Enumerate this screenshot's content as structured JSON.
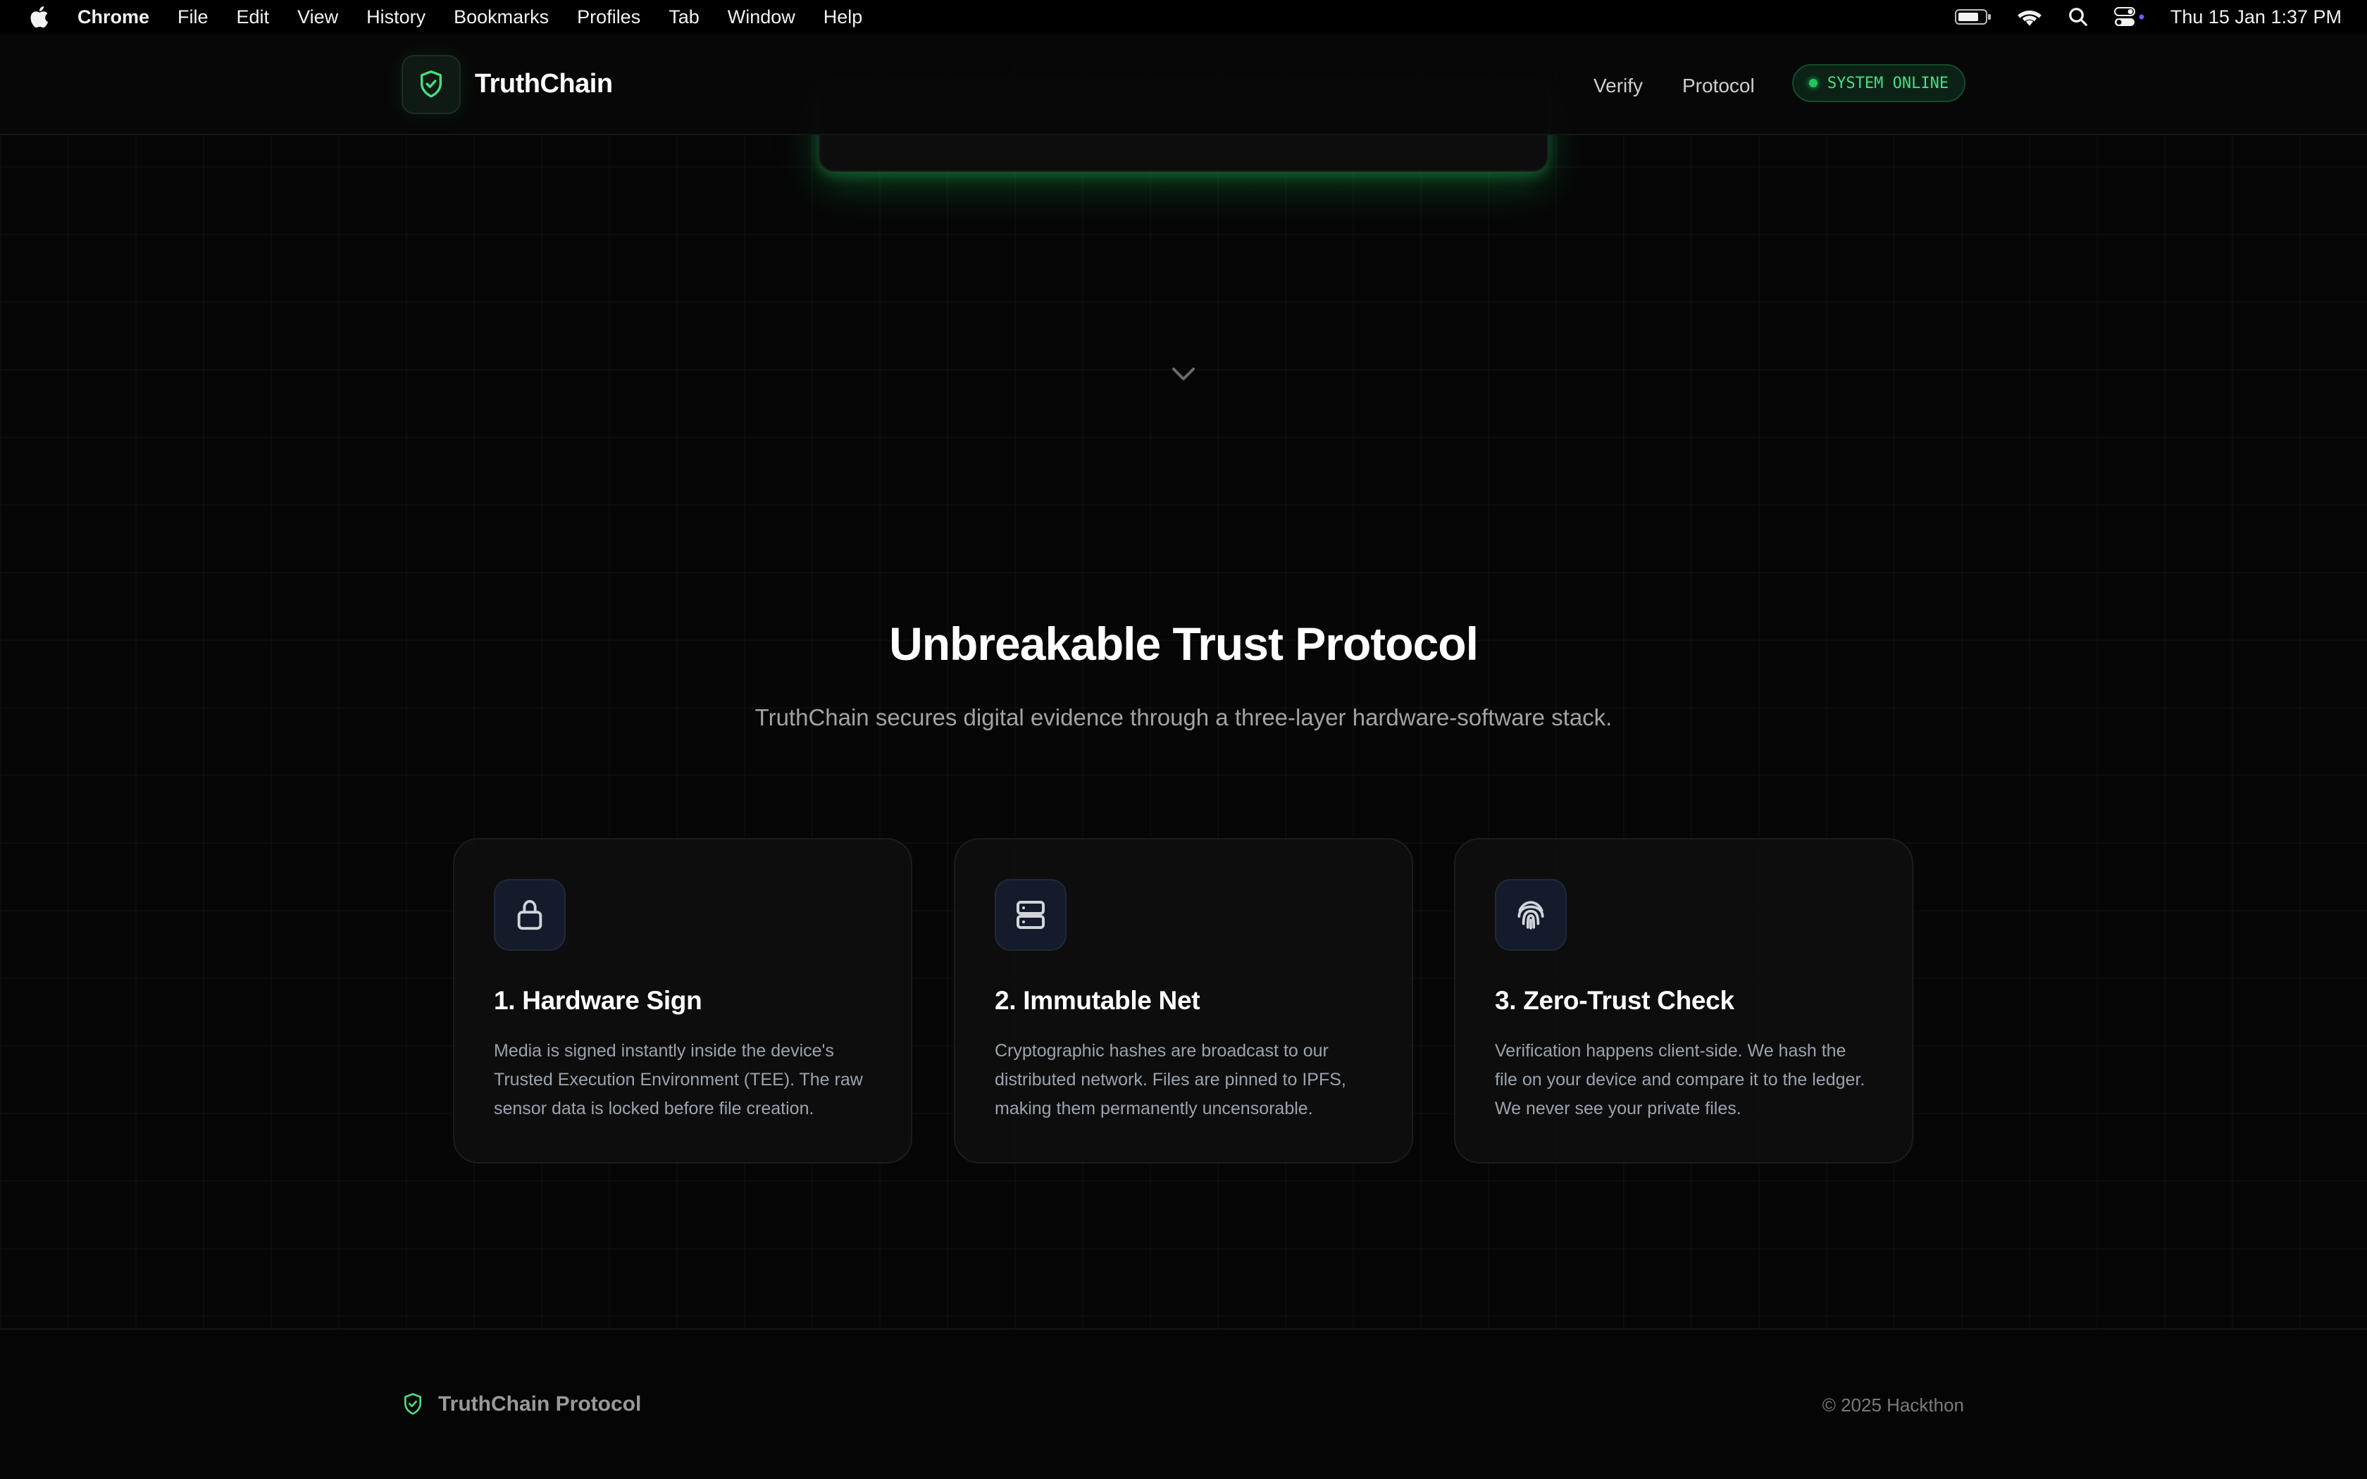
{
  "menubar": {
    "app_name": "Chrome",
    "menus": [
      "File",
      "Edit",
      "View",
      "History",
      "Bookmarks",
      "Profiles",
      "Tab",
      "Window",
      "Help"
    ],
    "clock": "Thu 15 Jan  1:37 PM"
  },
  "header": {
    "brand": "TruthChain",
    "nav": [
      "Verify",
      "Protocol"
    ],
    "status": "SYSTEM ONLINE"
  },
  "section": {
    "title": "Unbreakable Trust Protocol",
    "subtitle": "TruthChain secures digital evidence through a three-layer hardware-software stack."
  },
  "cards": [
    {
      "icon": "lock-icon",
      "title": "1. Hardware Sign",
      "text": "Media is signed instantly inside the device's Trusted Execution Environment (TEE). The raw sensor data is locked before file creation."
    },
    {
      "icon": "server-icon",
      "title": "2. Immutable Net",
      "text": "Cryptographic hashes are broadcast to our distributed network. Files are pinned to IPFS, making them permanently uncensorable."
    },
    {
      "icon": "fingerprint-icon",
      "title": "3. Zero-Trust Check",
      "text": "Verification happens client-side. We hash the file on your device and compare it to the ledger. We never see your private files."
    }
  ],
  "footer": {
    "brand": "TruthChain Protocol",
    "copyright": "© 2025 Hackthon"
  },
  "colors": {
    "accent": "#22c55e",
    "background": "#060606",
    "card_icon_bg": "#151b2b"
  }
}
